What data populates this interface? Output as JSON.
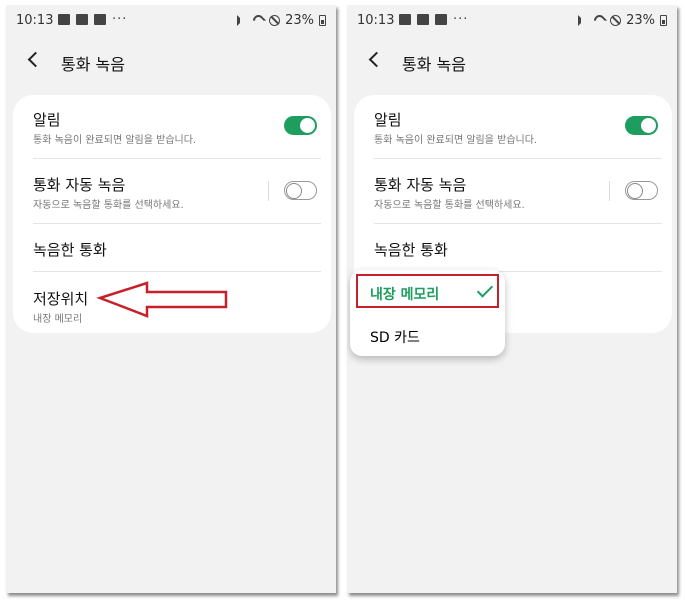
{
  "status_bar": {
    "time": "10:13",
    "more": "···",
    "battery": "23%"
  },
  "page": {
    "title": "통화 녹음"
  },
  "settings": {
    "alerts": {
      "title": "알림",
      "subtitle": "통화 녹음이 완료되면 알림을 받습니다.",
      "enabled": true
    },
    "auto_record": {
      "title": "통화 자동 녹음",
      "subtitle": "자동으로 녹음할 통화를 선택하세요.",
      "enabled": false
    },
    "recorded_calls": {
      "title": "녹음한 통화"
    },
    "storage": {
      "title": "저장위치",
      "value": "내장 메모리"
    }
  },
  "storage_popup": {
    "options": [
      {
        "label": "내장 메모리",
        "selected": true
      },
      {
        "label": "SD 카드",
        "selected": false
      }
    ]
  },
  "colors": {
    "accent": "#1e9e5e",
    "annotation": "#c8202a"
  },
  "icons": [
    "back-icon",
    "check-icon",
    "toggle-switch",
    "wifi-icon",
    "mute-icon",
    "do-not-disturb-icon",
    "battery-icon"
  ]
}
